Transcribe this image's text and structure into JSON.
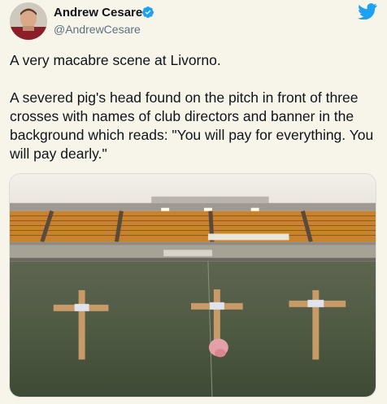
{
  "tweet": {
    "author_name": "Andrew Cesare",
    "author_handle": "@AndrewCesare",
    "verified": true,
    "paragraphs": [
      "A very macabre scene at Livorno.",
      "A severed pig's head found on the pitch in front of three crosses with names of club directors and banner in the background which reads: \"You will pay for everything. You will pay dearly.\""
    ]
  },
  "icons": {
    "logo": "twitter-bird-icon",
    "verified": "verified-badge-icon"
  },
  "colors": {
    "twitter_blue": "#1da1f2",
    "background": "#f7f5ea",
    "text": "#0f1419",
    "handle": "#5b7083"
  }
}
